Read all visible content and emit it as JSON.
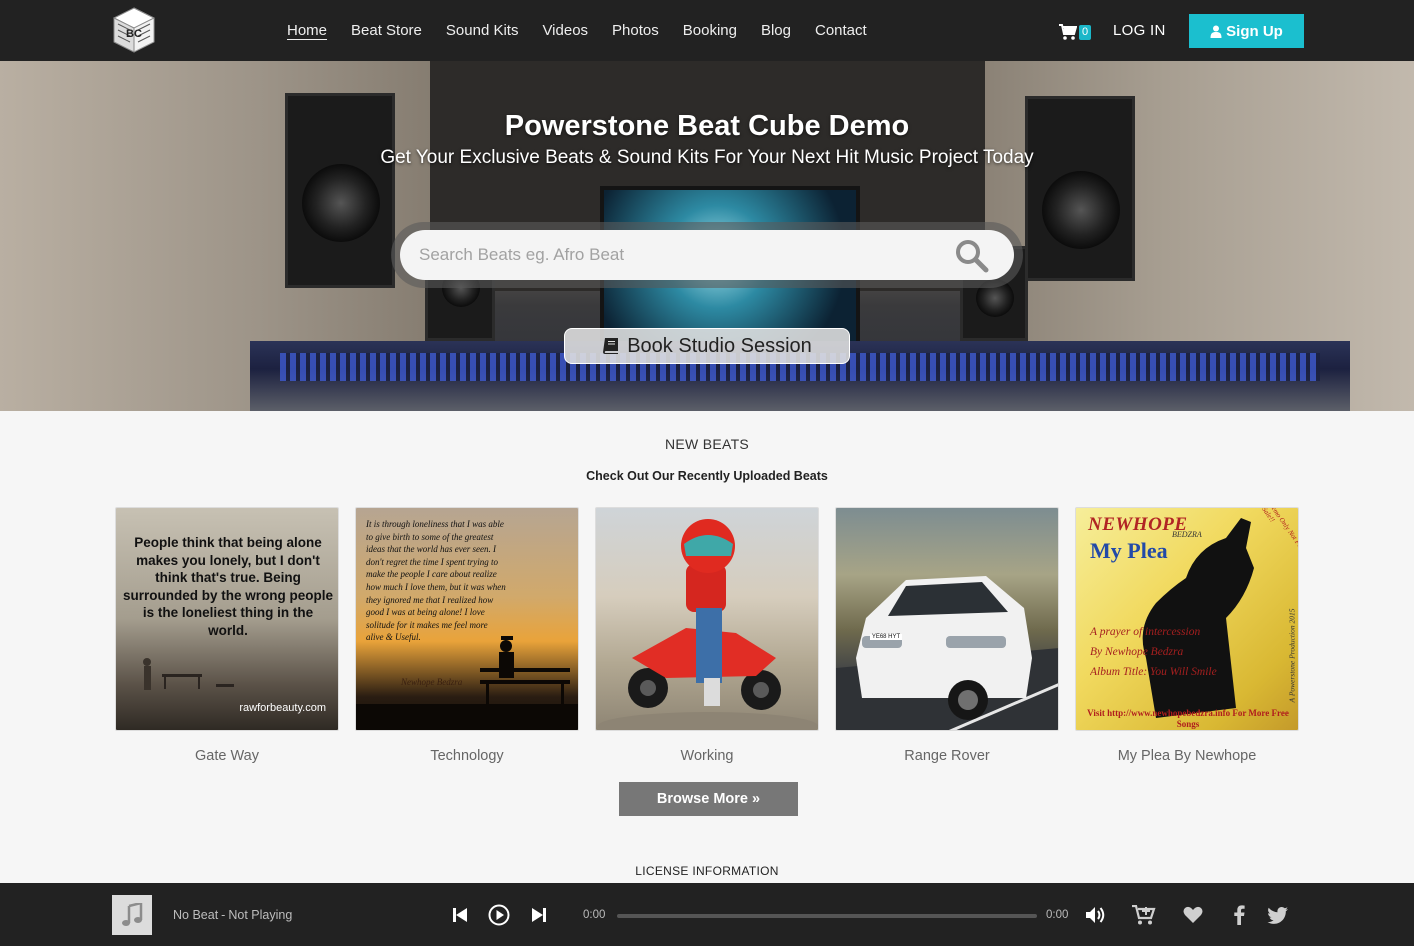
{
  "nav": {
    "logo_text": "BC",
    "links": [
      "Home",
      "Beat Store",
      "Sound Kits",
      "Videos",
      "Photos",
      "Booking",
      "Blog",
      "Contact"
    ],
    "cart_count": "0",
    "login_label": "LOG IN",
    "signup_label": "Sign Up"
  },
  "hero": {
    "title": "Powerstone Beat Cube Demo",
    "subtitle": "Get Your Exclusive Beats & Sound Kits For Your Next Hit Music Project Today",
    "search_placeholder": "Search Beats eg. Afro Beat",
    "book_label": "Book Studio Session"
  },
  "new_beats": {
    "title": "NEW BEATS",
    "subtitle": "Check Out Our Recently Uploaded Beats",
    "items": [
      {
        "title": "Gate Way",
        "art_quote": "People think that being alone makes you lonely, but I don't think that's true. Being surrounded by the wrong people is the loneliest thing in the world.",
        "art_credit": "rawforbeauty.com"
      },
      {
        "title": "Technology",
        "art_quote": "It is through loneliness that I was able to give birth to some of the greatest ideas that the world has ever seen. I don't regret the time I spent trying to make the people I care about realize how much I love them, but it was when they ignored me that I realized how good I was at being alone! I love solitude for it makes me feel more alive & Useful.",
        "art_credit": "Newhope Bedzra"
      },
      {
        "title": "Working"
      },
      {
        "title": "Range Rover",
        "art_plate": "YE68 HYT"
      },
      {
        "title": "My Plea By Newhope",
        "art_title1": "NEWHOPE",
        "art_sub1": "BEDZRA",
        "art_title2": "My Plea",
        "art_line1": "A prayer of intercession",
        "art_line2": "By Newhope Bedzra",
        "art_line3": "Album Title: You Will Smile",
        "art_footer": "Visit http://www.newhopebedzra.info For More Free Songs",
        "art_side": "A Powerstone Production 2015",
        "art_corner": "Demo Only Not For Sale!!"
      }
    ],
    "browse_label": "Browse More »"
  },
  "license": {
    "title": "LICENSE INFORMATION"
  },
  "player": {
    "beat": "No Beat",
    "status": "Not Playing",
    "separator": "-",
    "time_current": "0:00",
    "time_total": "0:00",
    "progress_fraction": 0
  },
  "colors": {
    "accent": "#1bbfcf",
    "navbar": "#222222",
    "player": "#222222",
    "browse_button": "#777777",
    "page_bg": "#f6f6f6"
  },
  "icons": {
    "logo": "cube-logo-icon",
    "cart": "shopping-cart-icon",
    "signup": "user-icon",
    "search": "search-icon",
    "book": "book-icon",
    "music": "music-note-icon",
    "prev": "skip-back-icon",
    "play": "play-icon",
    "next": "skip-forward-icon",
    "volume": "volume-icon",
    "add_cart": "cart-plus-icon",
    "like": "heart-icon",
    "facebook": "facebook-icon",
    "twitter": "twitter-icon"
  }
}
